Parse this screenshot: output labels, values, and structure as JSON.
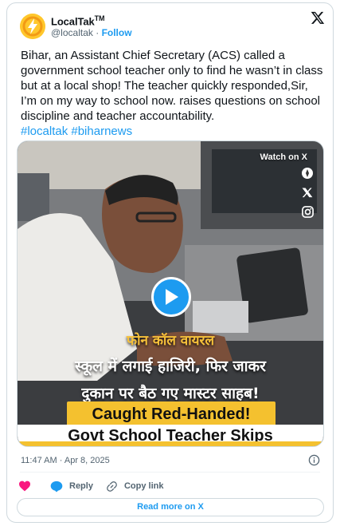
{
  "account": {
    "name": "LocalTak",
    "trademark": "TM",
    "handle": "@localtak",
    "follow_label": "Follow"
  },
  "tweet": {
    "text": "Bihar, an Assistant Chief Secretary (ACS) called a government school teacher only to find he wasn’t in class but at a local shop! The teacher quickly responded,Sir, I’m on my way to school now. raises questions on school discipline and teacher accountability.",
    "hashtags": "#localtak #biharnews"
  },
  "media": {
    "watch_label": "Watch on X",
    "caption_hindi_1": "फोन कॉल वायरल",
    "caption_hindi_2": "स्कूल में लगाई हाजिरी, फिर जाकर",
    "caption_hindi_3": "दुकान पर बैठ गए मास्टर साहब!",
    "banner_1": "Caught Red-Handed!",
    "banner_2": "Govt School Teacher Skips"
  },
  "meta": {
    "time": "11:47 AM",
    "sep": "·",
    "date": "Apr 8, 2025"
  },
  "actions": {
    "reply_label": "Reply",
    "copy_link_label": "Copy link"
  },
  "footer": {
    "read_more_label": "Read more on X"
  },
  "colors": {
    "accent": "#1d9bf0",
    "like": "#f91880",
    "banner_yellow": "#f4c12f"
  }
}
